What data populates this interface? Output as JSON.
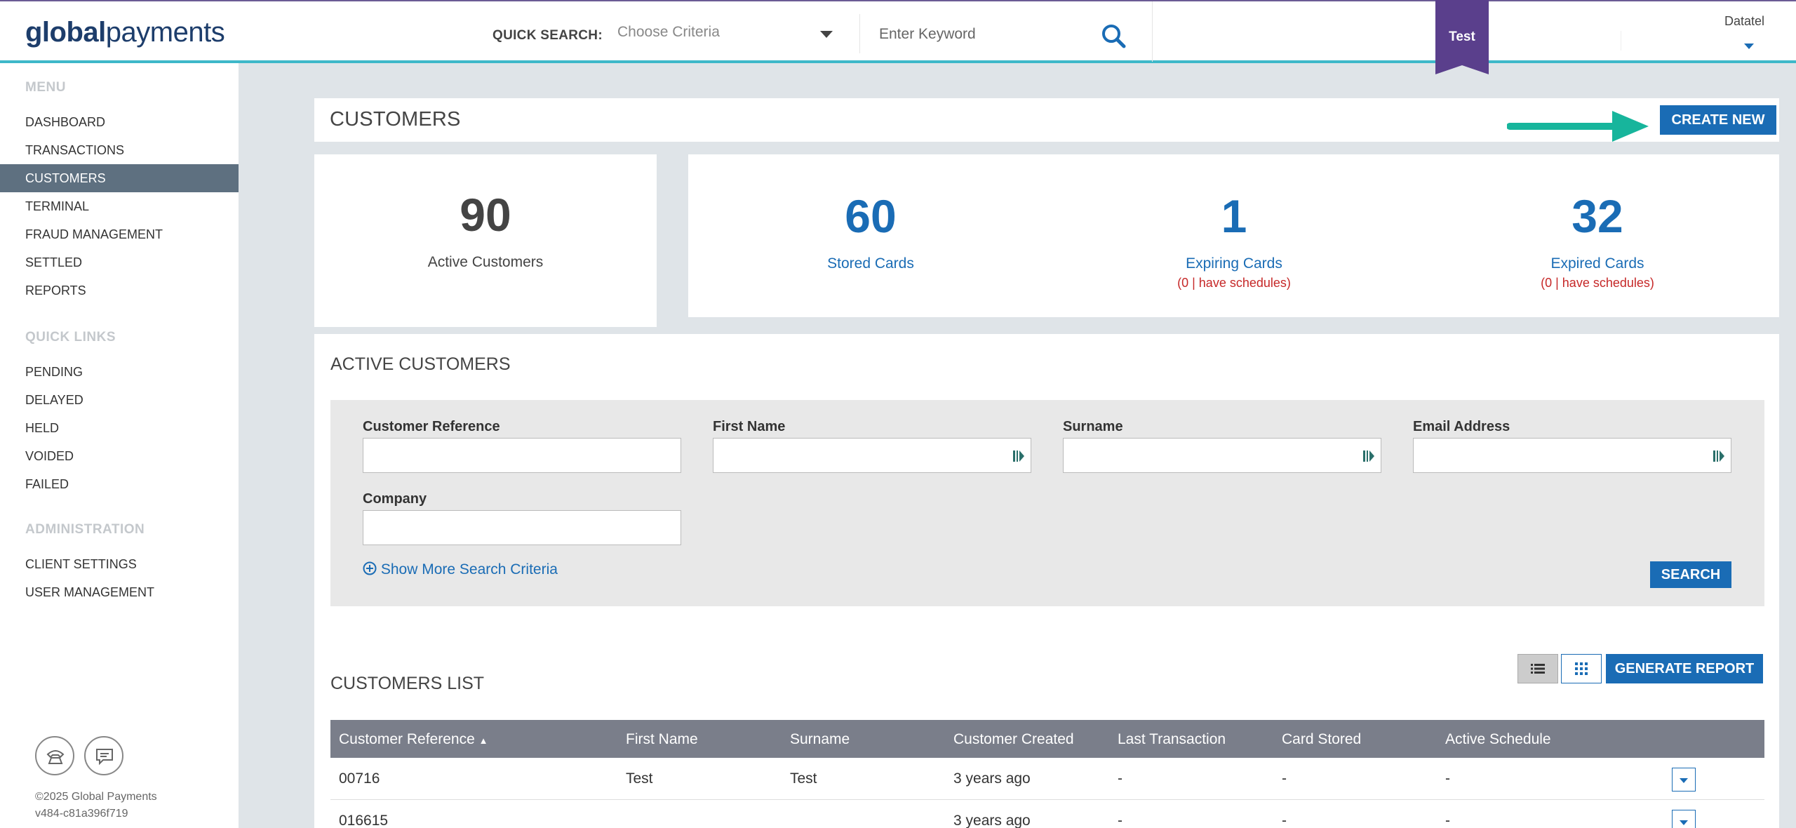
{
  "brand": {
    "logo_bold": "global",
    "logo_light": "payments"
  },
  "topbar": {
    "quick_search_label": "QUICK SEARCH:",
    "criteria_placeholder": "Choose Criteria",
    "keyword_placeholder": "Enter Keyword",
    "env_tag": "Test",
    "user_name": "Datatel"
  },
  "sidebar": {
    "menu_heading": "MENU",
    "menu_items": [
      {
        "label": "DASHBOARD"
      },
      {
        "label": "TRANSACTIONS"
      },
      {
        "label": "CUSTOMERS",
        "active": true
      },
      {
        "label": "TERMINAL"
      },
      {
        "label": "FRAUD MANAGEMENT"
      },
      {
        "label": "SETTLED"
      },
      {
        "label": "REPORTS"
      }
    ],
    "quick_links_heading": "QUICK LINKS",
    "quick_links": [
      {
        "label": "PENDING"
      },
      {
        "label": "DELAYED"
      },
      {
        "label": "HELD"
      },
      {
        "label": "VOIDED"
      },
      {
        "label": "FAILED"
      }
    ],
    "admin_heading": "ADMINISTRATION",
    "admin_items": [
      {
        "label": "CLIENT SETTINGS"
      },
      {
        "label": "USER MANAGEMENT"
      }
    ],
    "copyright": "©2025 Global Payments",
    "version": "v484-c81a396f719"
  },
  "page": {
    "title": "CUSTOMERS",
    "create_button": "CREATE NEW"
  },
  "stats": {
    "active_customers": {
      "value": "90",
      "label": "Active Customers"
    },
    "stored_cards": {
      "value": "60",
      "label": "Stored Cards"
    },
    "expiring_cards": {
      "value": "1",
      "label": "Expiring Cards",
      "sub": "(0 | have schedules)"
    },
    "expired_cards": {
      "value": "32",
      "label": "Expired Cards",
      "sub": "(0 | have schedules)"
    }
  },
  "active_customers_section": {
    "title": "ACTIVE CUSTOMERS",
    "fields": {
      "customer_reference": "Customer Reference",
      "first_name": "First Name",
      "surname": "Surname",
      "email": "Email Address",
      "company": "Company"
    },
    "show_more": "Show More Search Criteria",
    "search_button": "SEARCH"
  },
  "customers_list": {
    "title": "CUSTOMERS LIST",
    "generate_report": "GENERATE REPORT",
    "columns": [
      "Customer Reference",
      "First Name",
      "Surname",
      "Customer Created",
      "Last Transaction",
      "Card Stored",
      "Active Schedule"
    ],
    "sort_indicator": "▲",
    "rows": [
      {
        "ref": "00716",
        "first": "Test",
        "surname": "Test",
        "created": "3 years ago",
        "last_txn": "-",
        "card": "-",
        "schedule": "-"
      },
      {
        "ref": "016615",
        "first": "",
        "surname": "",
        "created": "3 years ago",
        "last_txn": "-",
        "card": "-",
        "schedule": "-"
      }
    ]
  },
  "colors": {
    "accent_blue": "#1a6cb5",
    "ribbon_purple": "#5a3f8c",
    "arrow_teal": "#17b59c",
    "alert_red": "#c62828"
  }
}
